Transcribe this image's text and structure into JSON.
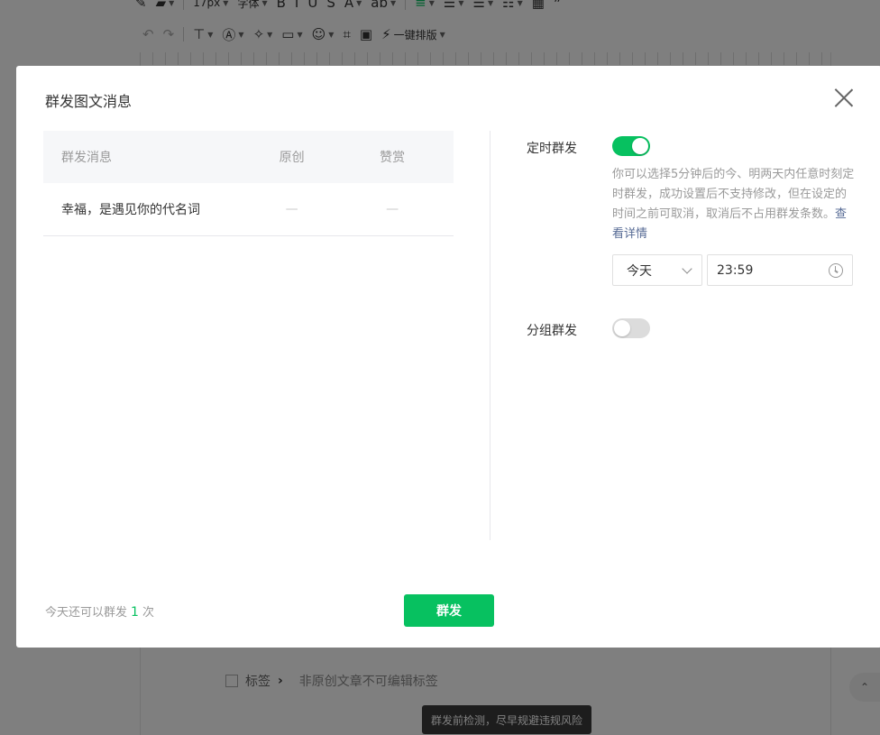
{
  "background": {
    "toolbar_row1": [
      "17px",
      "字体",
      "B",
      "I",
      "U",
      "S",
      "A",
      "ab"
    ],
    "toolbar_row2_extra": "一键排版",
    "tag_label": "标签",
    "tag_hint": "非原创文章不可编辑标签",
    "tooltip": "群发前检测，尽早规避违规风险"
  },
  "dialog": {
    "title": "群发图文消息",
    "table": {
      "headers": [
        "群发消息",
        "原创",
        "赞赏"
      ],
      "rows": [
        {
          "title": "幸福，是遇见你的代名词",
          "original": "—",
          "reward": "—"
        }
      ]
    },
    "scheduled": {
      "label": "定时群发",
      "enabled": true,
      "hint": "你可以选择5分钟后的今、明两天内任意时刻定时群发，成功设置后不支持修改，但在设定的时间之前可取消，取消后不占用群发条数。",
      "hint_link": "查看详情",
      "day_value": "今天",
      "time_value": "23:59"
    },
    "group_send": {
      "label": "分组群发",
      "enabled": false
    },
    "footer": {
      "quota_prefix": "今天还可以群发",
      "quota_count": "1",
      "quota_suffix": "次",
      "send_label": "群发"
    }
  },
  "colors": {
    "accent": "#07c160",
    "link": "#576b95",
    "overlay": "rgba(0,0,0,0.5)"
  }
}
